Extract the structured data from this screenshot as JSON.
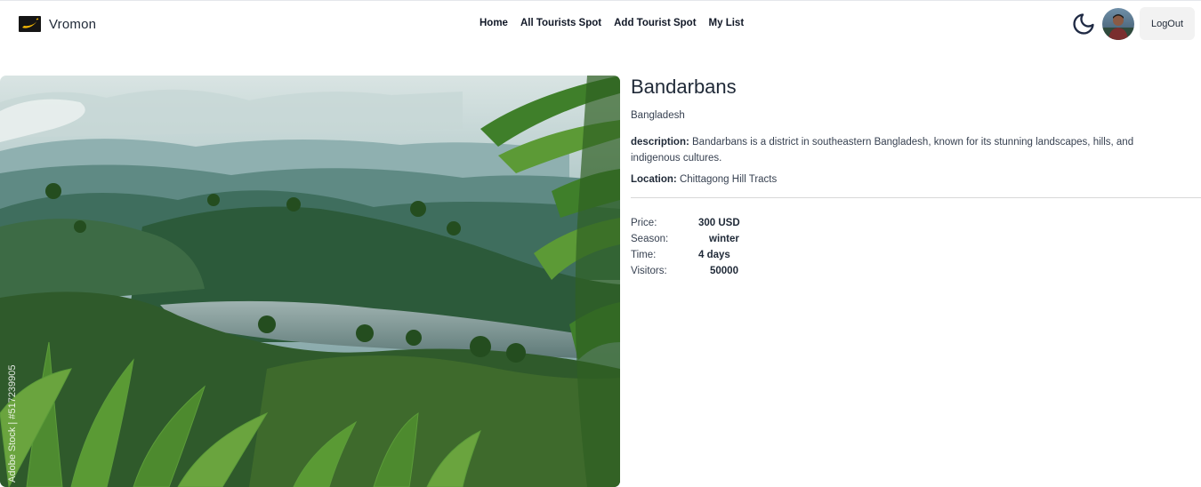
{
  "brand": {
    "name": "Vromon"
  },
  "nav": {
    "links": [
      {
        "label": "Home"
      },
      {
        "label": "All Tourists Spot"
      },
      {
        "label": "Add Tourist Spot"
      },
      {
        "label": "My List"
      }
    ],
    "logout_label": "LogOut"
  },
  "hero": {
    "watermark": "Adobe Stock | #517239905"
  },
  "spot": {
    "name": "Bandarbans",
    "country": "Bangladesh",
    "description_label": "description:",
    "description": "Bandarbans is a district in southeastern Bangladesh, known for its stunning landscapes, hills, and indigenous cultures.",
    "location_label": "Location:",
    "location": "Chittagong Hill Tracts",
    "stats": [
      {
        "label": "Price:",
        "value": "300 USD"
      },
      {
        "label": "Season:",
        "value": "winter"
      },
      {
        "label": "Time:",
        "value": "4 days"
      },
      {
        "label": "Visitors:",
        "value": "50000"
      }
    ]
  },
  "icons": {
    "brand": "banana-logo-icon",
    "theme": "moon-icon",
    "avatar": "user-avatar"
  },
  "colors": {
    "text": "#1f2937",
    "button_bg": "#f2f2f2",
    "divider": "#d8d8d8"
  }
}
